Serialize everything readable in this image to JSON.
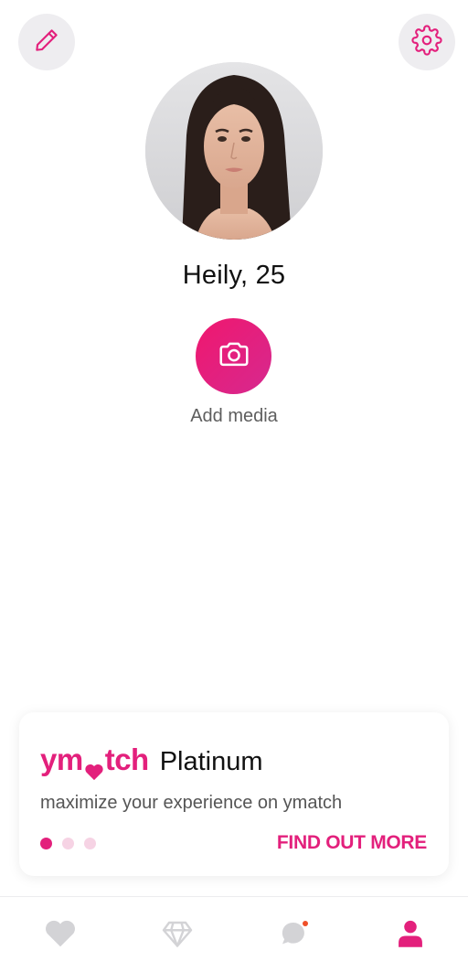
{
  "header": {
    "edit_icon": "pencil-icon",
    "settings_icon": "gear-icon"
  },
  "profile": {
    "name_age": "Heily, 25",
    "add_media_label": "Add media",
    "camera_icon": "camera-icon"
  },
  "promo": {
    "brand": "ymatch",
    "tier": "Platinum",
    "subtitle": "maximize your experience on ymatch",
    "cta": "FIND OUT MORE",
    "carousel_active_index": 0,
    "carousel_count": 3
  },
  "tabbar": {
    "items": [
      {
        "icon": "heart-icon"
      },
      {
        "icon": "diamond-icon"
      },
      {
        "icon": "chat-icon",
        "has_notification": true
      },
      {
        "icon": "profile-icon",
        "active": true
      }
    ]
  },
  "colors": {
    "accent": "#e3207c",
    "accent_light": "#f6d3e4",
    "inactive_icon": "#d3d3d6",
    "notification": "#ef4f28"
  }
}
